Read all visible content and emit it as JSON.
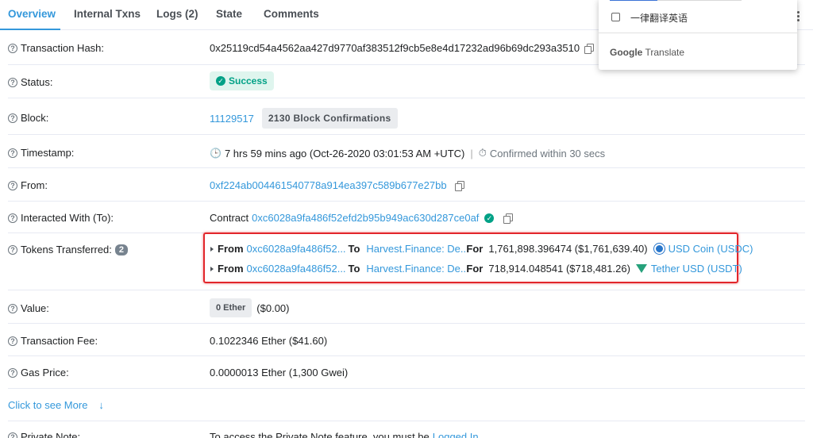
{
  "tabs": [
    {
      "label": "Overview"
    },
    {
      "label": "Internal Txns"
    },
    {
      "label": "Logs (2)"
    },
    {
      "label": "State"
    },
    {
      "label": "Comments"
    }
  ],
  "fields": {
    "tx_hash": {
      "label": "Transaction Hash:",
      "value": "0x25119cd54a4562aa427d9770af383512f9cb5e8e4d17232ad96b69dc293a3510"
    },
    "status": {
      "label": "Status:",
      "value": "Success"
    },
    "block": {
      "label": "Block:",
      "number": "11129517",
      "confirmations": "2130 Block Confirmations"
    },
    "timestamp": {
      "label": "Timestamp:",
      "value": "7 hrs 59 mins ago (Oct-26-2020 03:01:53 AM +UTC)",
      "separator": "|",
      "confirmed": "Confirmed within 30 secs"
    },
    "from": {
      "label": "From:",
      "value": "0xf224ab004461540778a914ea397c589b677e27bb"
    },
    "to": {
      "label": "Interacted With (To):",
      "prefix": "Contract",
      "value": "0xc6028a9fa486f52efd2b95b949ac630d287ce0af"
    },
    "tokens": {
      "label": "Tokens Transferred:",
      "count": "2",
      "transfers": [
        {
          "from_label": "From",
          "from": "0xc6028a9fa486f52...",
          "to_label": "To",
          "to": "Harvest.Finance: De...",
          "for_label": "For",
          "amount": "1,761,898.396474 ($1,761,639.40)",
          "token": "USD Coin (USDC)",
          "icon": "usdc-icon"
        },
        {
          "from_label": "From",
          "from": "0xc6028a9fa486f52...",
          "to_label": "To",
          "to": "Harvest.Finance: De...",
          "for_label": "For",
          "amount": "718,914.048541 ($718,481.26)",
          "token": "Tether USD (USDT)",
          "icon": "usdt-icon"
        }
      ]
    },
    "value": {
      "label": "Value:",
      "ether": "0 Ether",
      "usd": "($0.00)"
    },
    "fee": {
      "label": "Transaction Fee:",
      "value": "0.1022346 Ether ($41.60)"
    },
    "gas": {
      "label": "Gas Price:",
      "value": "0.0000013 Ether (1,300 Gwei)"
    }
  },
  "more": {
    "label": "Click to see More"
  },
  "private_note": {
    "label": "Private Note:",
    "text": "To access the Private Note feature, you must be",
    "link": "Logged In"
  },
  "translate_popup": {
    "option": "一律翻译英语",
    "brand_prefix": "Google",
    "brand_suffix": "Translate"
  },
  "colors": {
    "accent": "#3498db",
    "success": "#00a186",
    "highlight_box": "#e2262b"
  }
}
